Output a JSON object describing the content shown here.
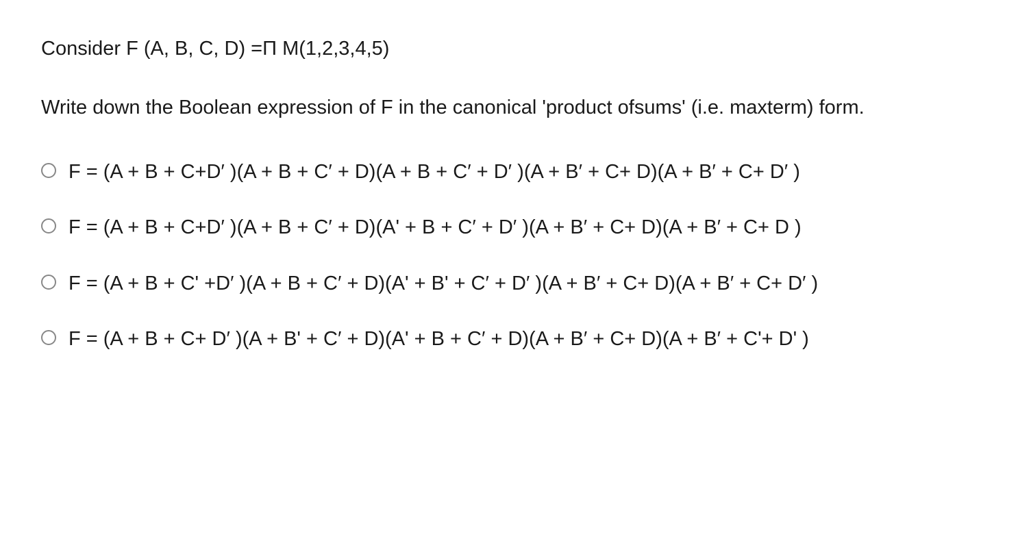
{
  "question": {
    "stem": "Consider F (A, B, C, D) =Π M(1,2,3,4,5)",
    "prompt": "Write down the Boolean expression of F in the canonical 'product ofsums' (i.e. maxterm) form."
  },
  "options": [
    {
      "text": "F = (A + B + C+D′ )(A + B + C′ + D)(A + B + C′ + D′ )(A + B′ + C+ D)(A + B′ + C+ D′ )"
    },
    {
      "text": "F = (A + B + C+D′ )(A + B + C′ + D)(A' + B + C′ + D′ )(A + B′ + C+ D)(A + B′ + C+ D )"
    },
    {
      "text": "F = (A + B + C' +D′ )(A + B + C′ + D)(A' + B' + C′ + D′ )(A + B′ + C+ D)(A + B′ + C+ D′ )"
    },
    {
      "text": "F = (A + B + C+ D′ )(A + B' + C′ + D)(A' + B + C′ + D)(A + B′ + C+ D)(A + B′ + C'+ D' )"
    }
  ]
}
